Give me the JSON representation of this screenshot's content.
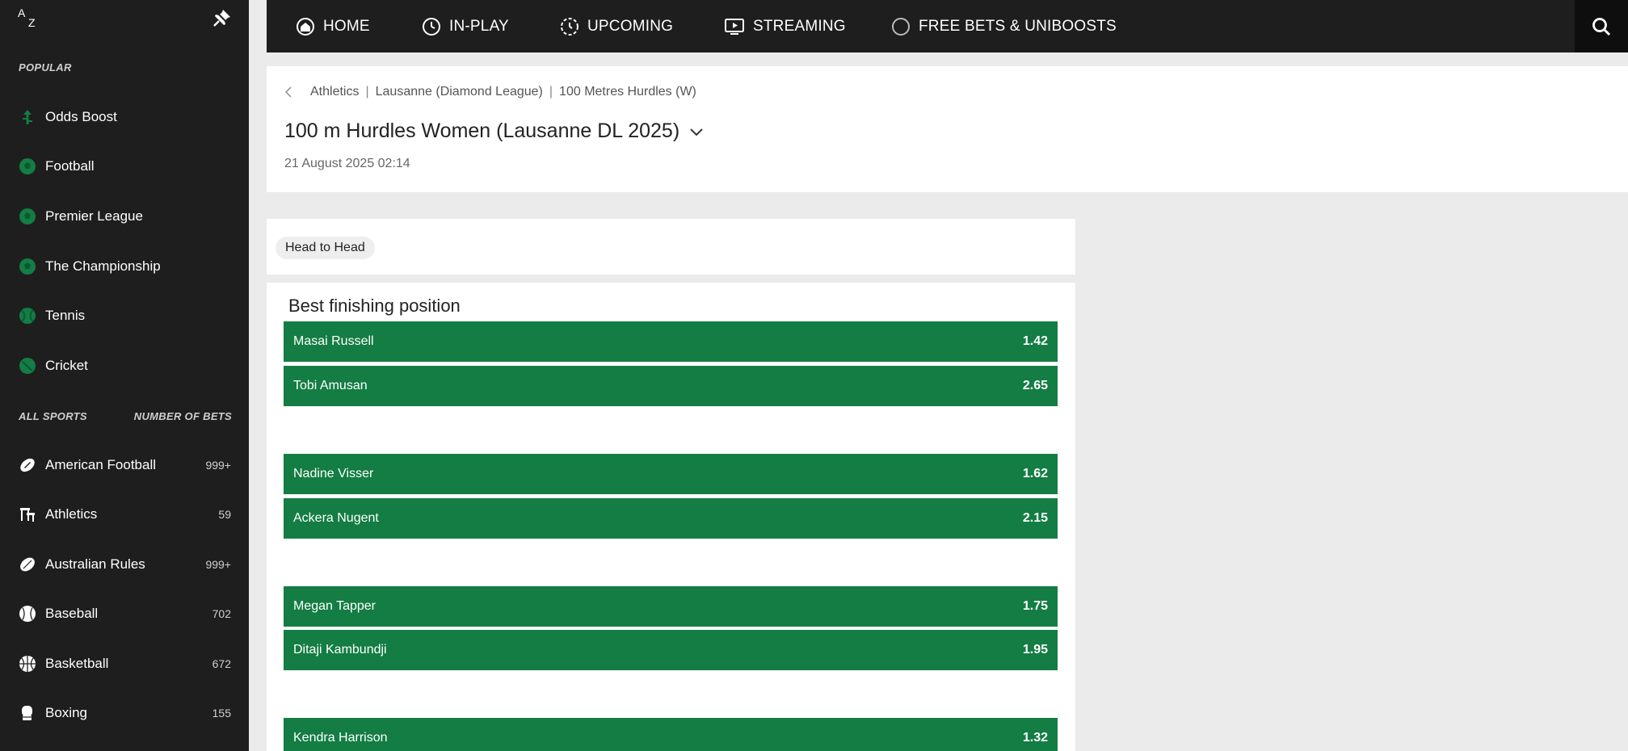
{
  "sidebar": {
    "az_a": "A",
    "az_z": "Z",
    "popular_heading": "POPULAR",
    "popular": [
      {
        "label": "Odds Boost",
        "icon": "odds-boost-icon"
      },
      {
        "label": "Football",
        "icon": "football-icon"
      },
      {
        "label": "Premier League",
        "icon": "football-icon"
      },
      {
        "label": "The Championship",
        "icon": "football-icon"
      },
      {
        "label": "Tennis",
        "icon": "tennis-icon"
      },
      {
        "label": "Cricket",
        "icon": "cricket-icon"
      }
    ],
    "all_sports_heading": "ALL SPORTS",
    "number_of_bets_heading": "NUMBER OF BETS",
    "sports": [
      {
        "label": "American Football",
        "count": "999+",
        "icon": "american-football-icon"
      },
      {
        "label": "Athletics",
        "count": "59",
        "icon": "athletics-icon"
      },
      {
        "label": "Australian Rules",
        "count": "999+",
        "icon": "australian-rules-icon"
      },
      {
        "label": "Baseball",
        "count": "702",
        "icon": "baseball-icon"
      },
      {
        "label": "Basketball",
        "count": "672",
        "icon": "basketball-icon"
      },
      {
        "label": "Boxing",
        "count": "155",
        "icon": "boxing-icon"
      }
    ]
  },
  "nav": {
    "items": [
      {
        "label": "HOME",
        "icon": "home-icon"
      },
      {
        "label": "IN-PLAY",
        "icon": "in-play-icon"
      },
      {
        "label": "UPCOMING",
        "icon": "upcoming-icon"
      },
      {
        "label": "STREAMING",
        "icon": "streaming-icon"
      },
      {
        "label": "FREE BETS & UNIBOOSTS",
        "icon": "free-bets-icon"
      }
    ]
  },
  "event": {
    "breadcrumb": [
      "Athletics",
      "Lausanne (Diamond League)",
      "100 Metres Hurdles (W)"
    ],
    "title": "100 m Hurdles Women (Lausanne DL 2025)",
    "date": "21 August 2025 02:14"
  },
  "filter": {
    "chip": "Head to Head"
  },
  "market": {
    "title": "Best finishing position",
    "outcomes": [
      {
        "name": "Masai Russell",
        "odds": "1.42"
      },
      {
        "name": "Tobi Amusan",
        "odds": "2.65"
      },
      {
        "name": "Nadine Visser",
        "odds": "1.62"
      },
      {
        "name": "Ackera Nugent",
        "odds": "2.15"
      },
      {
        "name": "Megan Tapper",
        "odds": "1.75"
      },
      {
        "name": "Ditaji Kambundji",
        "odds": "1.95"
      },
      {
        "name": "Kendra Harrison",
        "odds": "1.32"
      }
    ]
  },
  "colors": {
    "accent_green": "#137d43",
    "sidebar_bg": "#1e1e1e",
    "page_bg": "#ebebeb"
  }
}
